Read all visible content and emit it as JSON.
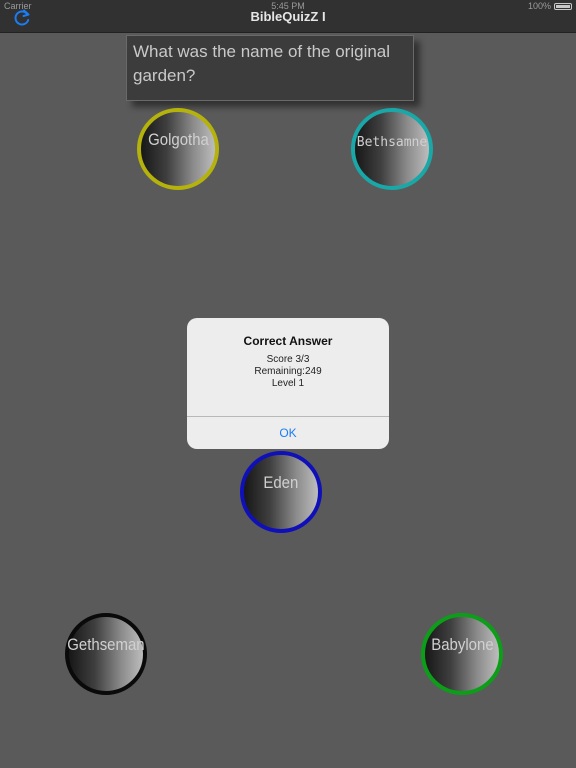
{
  "status_bar": {
    "carrier": "Carrier",
    "time": "5:45 PM",
    "battery": "100%"
  },
  "navbar": {
    "title": "BibleQuizZ I",
    "refresh_icon": "refresh-icon"
  },
  "question": {
    "text": "What was the name of the original garden?"
  },
  "answers": [
    {
      "label": "Golgotha",
      "color": "#b5b20c"
    },
    {
      "label": "Bethsamne",
      "color": "#1aa7a7"
    },
    {
      "label": "Eden",
      "color": "#1010b8"
    },
    {
      "label": "Gethseman",
      "color": "#0a0a0a"
    },
    {
      "label": "Babylone",
      "color": "#0c9e18"
    }
  ],
  "alert": {
    "title": "Correct Answer",
    "score": "Score 3/3",
    "remaining": "Remaining:249",
    "level": "Level 1",
    "ok_label": "OK"
  }
}
